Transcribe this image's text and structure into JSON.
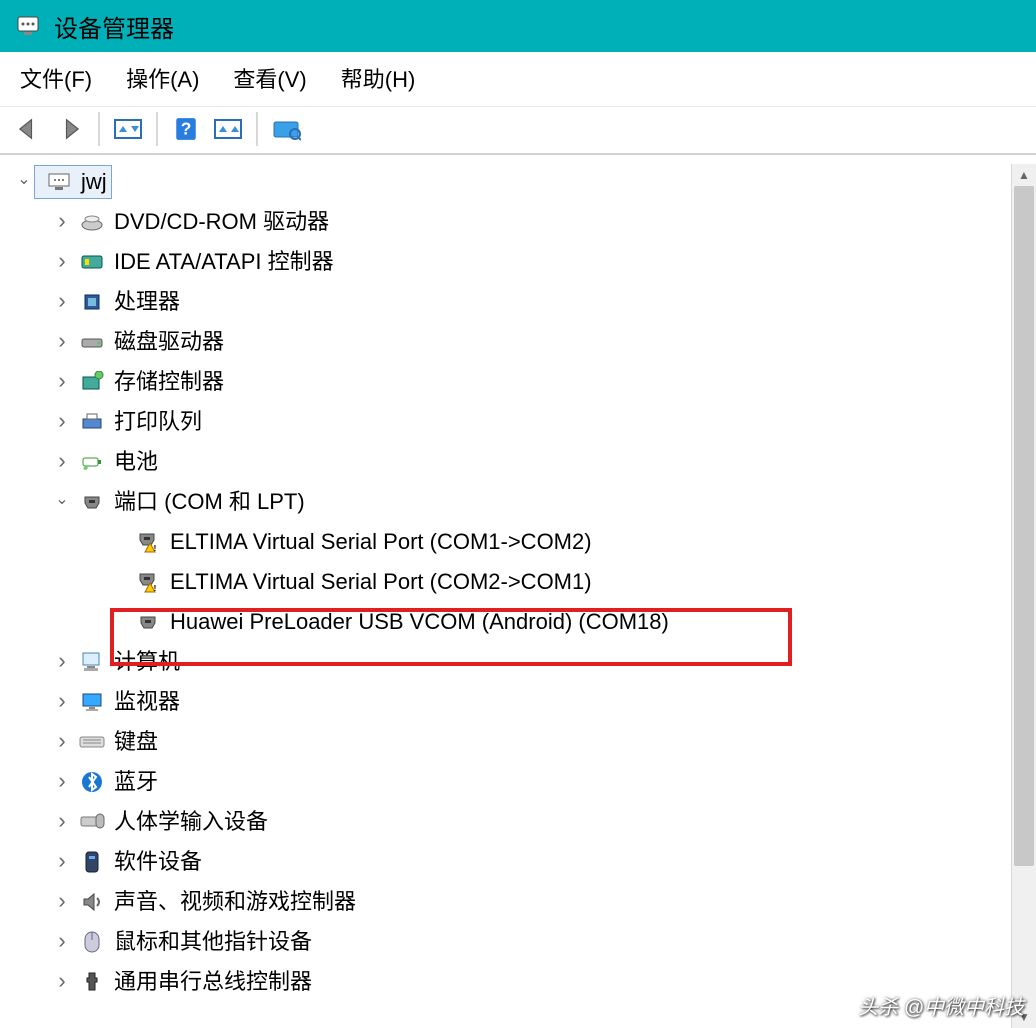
{
  "window": {
    "title": "设备管理器"
  },
  "menu": {
    "file": "文件(F)",
    "action": "操作(A)",
    "view": "查看(V)",
    "help": "帮助(H)"
  },
  "tree": {
    "root": "jwj",
    "categories": [
      {
        "label": "DVD/CD-ROM 驱动器",
        "icon": "disc"
      },
      {
        "label": "IDE ATA/ATAPI 控制器",
        "icon": "card"
      },
      {
        "label": "处理器",
        "icon": "cpu"
      },
      {
        "label": "磁盘驱动器",
        "icon": "hdd"
      },
      {
        "label": "存储控制器",
        "icon": "storage"
      },
      {
        "label": "打印队列",
        "icon": "printer"
      },
      {
        "label": "电池",
        "icon": "battery"
      },
      {
        "label": "端口 (COM 和 LPT)",
        "icon": "port",
        "expanded": true,
        "children": [
          {
            "label": "ELTIMA Virtual Serial Port (COM1->COM2)",
            "icon": "port-warn"
          },
          {
            "label": "ELTIMA Virtual Serial Port (COM2->COM1)",
            "icon": "port-warn"
          },
          {
            "label": "Huawei PreLoader USB VCOM (Android) (COM18)",
            "icon": "port",
            "highlight": true
          }
        ]
      },
      {
        "label": "计算机",
        "icon": "computer"
      },
      {
        "label": "监视器",
        "icon": "monitor"
      },
      {
        "label": "键盘",
        "icon": "keyboard"
      },
      {
        "label": "蓝牙",
        "icon": "bluetooth"
      },
      {
        "label": "人体学输入设备",
        "icon": "hid"
      },
      {
        "label": "软件设备",
        "icon": "software"
      },
      {
        "label": "声音、视频和游戏控制器",
        "icon": "audio"
      },
      {
        "label": "鼠标和其他指针设备",
        "icon": "mouse"
      },
      {
        "label": "通用串行总线控制器",
        "icon": "usb"
      }
    ]
  },
  "watermark": "头杀 @中微中科技"
}
